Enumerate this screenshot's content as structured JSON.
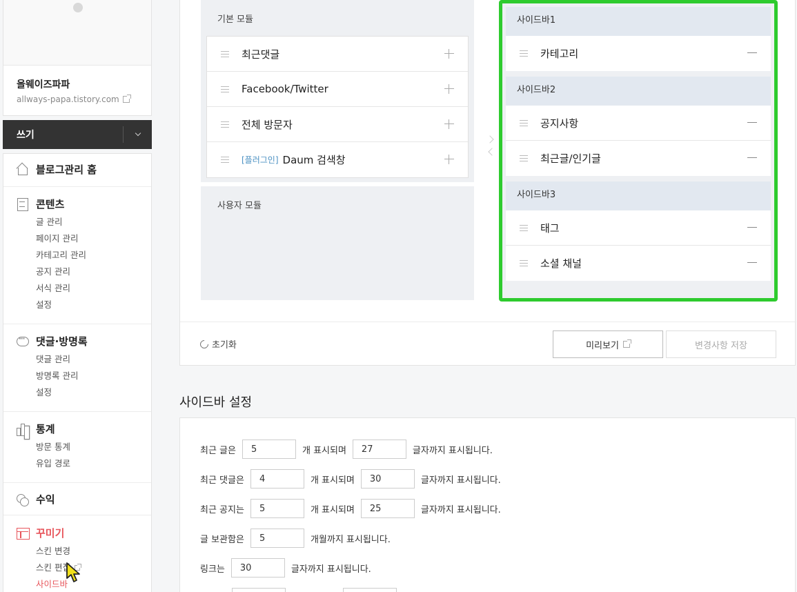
{
  "profile": {
    "blog_name": "올웨이즈파파",
    "blog_url": "allways-papa.tistory.com"
  },
  "write": {
    "label": "쓰기"
  },
  "nav": {
    "home": "블로그관리 홈",
    "contents": {
      "label": "콘텐츠",
      "items": [
        "글 관리",
        "페이지 관리",
        "카테고리 관리",
        "공지 관리",
        "서식 관리",
        "설정"
      ]
    },
    "comments": {
      "label": "댓글·방명록",
      "items": [
        "댓글 관리",
        "방명록 관리",
        "설정"
      ]
    },
    "stats": {
      "label": "통계",
      "items": [
        "방문 통계",
        "유입 경로"
      ]
    },
    "revenue": {
      "label": "수익"
    },
    "deco": {
      "label": "꾸미기",
      "items": [
        "스킨 변경",
        "스킨 편집",
        "사이드바"
      ]
    }
  },
  "editor": {
    "basic_modules_title": "기본 모듈",
    "basic_modules": [
      {
        "tag": "",
        "label": "최근댓글"
      },
      {
        "tag": "",
        "label": "Facebook/Twitter"
      },
      {
        "tag": "",
        "label": "전체 방문자"
      },
      {
        "tag": "[플러그인]",
        "label": "Daum 검색창"
      }
    ],
    "user_modules_title": "사용자 모듈",
    "sidebars": [
      {
        "title": "사이드바1",
        "items": [
          "카테고리"
        ]
      },
      {
        "title": "사이드바2",
        "items": [
          "공지사항",
          "최근글/인기글"
        ]
      },
      {
        "title": "사이드바3",
        "items": [
          "태그",
          "소셜 채널"
        ]
      }
    ],
    "reset_label": "초기화",
    "preview_label": "미리보기",
    "save_label": "변경사항 저장"
  },
  "settings": {
    "title": "사이드바 설정",
    "recent_posts": {
      "pre": "최근 글은",
      "count": "5",
      "mid": "개 표시되며",
      "chars": "27",
      "post": "글자까지 표시됩니다."
    },
    "recent_comments": {
      "pre": "최근 댓글은",
      "count": "4",
      "mid": "개 표시되며",
      "chars": "30",
      "post": "글자까지 표시됩니다."
    },
    "recent_notices": {
      "pre": "최근 공지는",
      "count": "5",
      "mid": "개 표시되며",
      "chars": "25",
      "post": "글자까지 표시됩니다."
    },
    "archive": {
      "pre": "글 보관함은",
      "count": "5",
      "post": "개월까지 표시됩니다."
    },
    "links": {
      "pre": "링크는",
      "chars": "30",
      "post": "글자까지 표시됩니다."
    }
  },
  "colors": {
    "accent": "#e7545a",
    "highlight": "#2ecb2e",
    "dark": "#333333"
  }
}
